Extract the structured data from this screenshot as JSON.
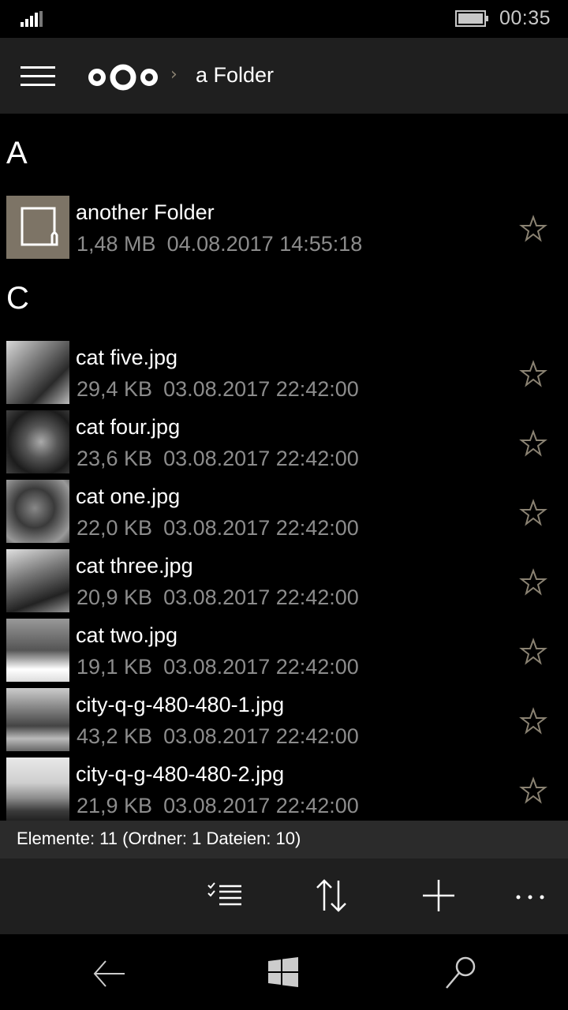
{
  "status_bar": {
    "signal_icon": "signal-bars-icon",
    "battery_icon": "battery-icon",
    "time": "00:35"
  },
  "header": {
    "menu_icon": "hamburger-icon",
    "logo": "nextcloud-logo",
    "breadcrumb_separator": "›",
    "title": "a Folder"
  },
  "colors": {
    "folder_tile": "#7d7466",
    "star_outline": "#8a8272",
    "meta_text": "#8c8c8c",
    "header_bg": "#1f1f1f",
    "summary_bg": "#2b2b2b"
  },
  "groups": [
    {
      "letter": "A",
      "items": [
        {
          "name": "another Folder",
          "size": "1,48 MB",
          "date": "04.08.2017 14:55:18",
          "type": "folder",
          "favorite": false
        }
      ]
    },
    {
      "letter": "C",
      "items": [
        {
          "name": "cat five.jpg",
          "size": "29,4 KB",
          "date": "03.08.2017 22:42:00",
          "type": "image",
          "favorite": false
        },
        {
          "name": "cat four.jpg",
          "size": "23,6 KB",
          "date": "03.08.2017 22:42:00",
          "type": "image",
          "favorite": false
        },
        {
          "name": "cat one.jpg",
          "size": "22,0 KB",
          "date": "03.08.2017 22:42:00",
          "type": "image",
          "favorite": false
        },
        {
          "name": "cat three.jpg",
          "size": "20,9 KB",
          "date": "03.08.2017 22:42:00",
          "type": "image",
          "favorite": false
        },
        {
          "name": "cat two.jpg",
          "size": "19,1 KB",
          "date": "03.08.2017 22:42:00",
          "type": "image",
          "favorite": false
        },
        {
          "name": "city-q-g-480-480-1.jpg",
          "size": "43,2 KB",
          "date": "03.08.2017 22:42:00",
          "type": "image",
          "favorite": false
        },
        {
          "name": "city-q-g-480-480-2.jpg",
          "size": "21,9 KB",
          "date": "03.08.2017 22:42:00",
          "type": "image",
          "favorite": false
        }
      ]
    }
  ],
  "summary": {
    "text": "Elemente: 11 (Ordner: 1 Dateien: 10)"
  },
  "app_bar": {
    "buttons": [
      {
        "icon": "select-list-icon",
        "label": "Select"
      },
      {
        "icon": "sort-icon",
        "label": "Sort"
      },
      {
        "icon": "add-icon",
        "label": "Add"
      },
      {
        "icon": "more-icon",
        "label": "More"
      }
    ]
  },
  "nav_bar": {
    "buttons": [
      {
        "icon": "back-arrow-icon",
        "label": "Back"
      },
      {
        "icon": "windows-start-icon",
        "label": "Start"
      },
      {
        "icon": "search-icon",
        "label": "Search"
      }
    ]
  }
}
